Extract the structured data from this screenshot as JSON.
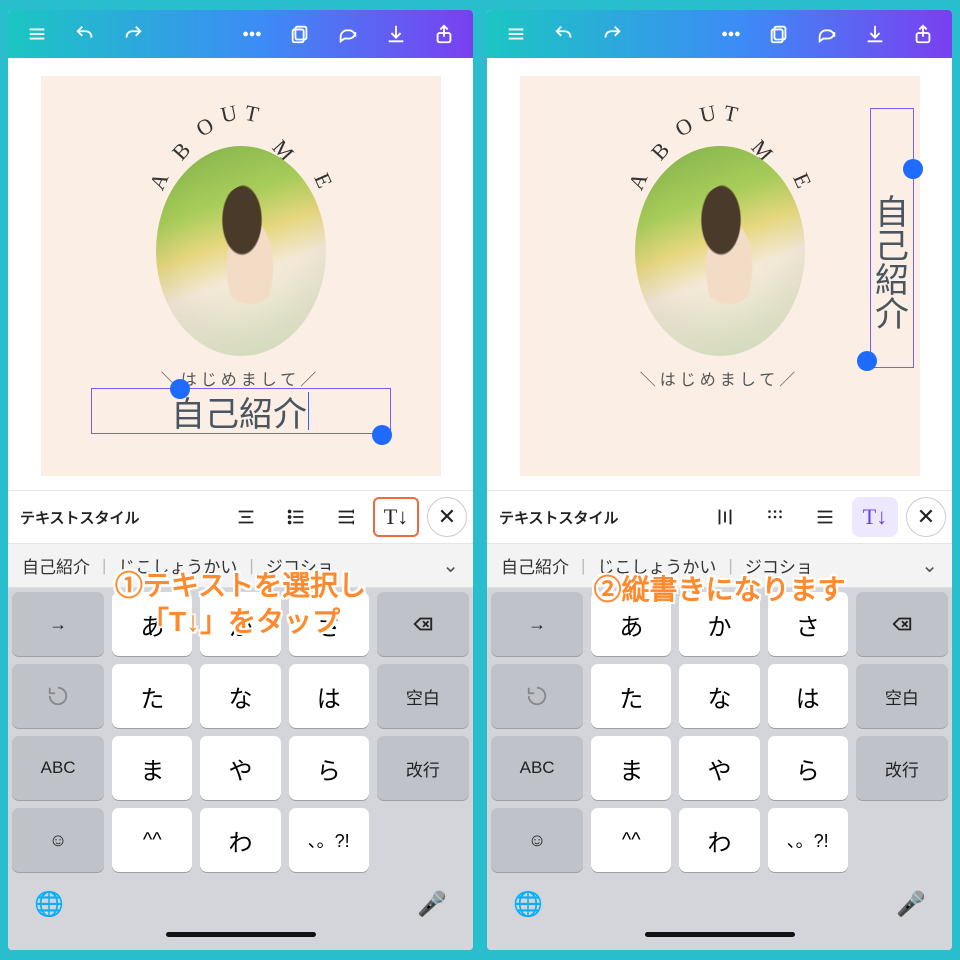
{
  "topbar": {
    "icons": [
      "menu",
      "undo",
      "redo",
      "more",
      "pages",
      "comment",
      "download",
      "share"
    ]
  },
  "canvas": {
    "arc_text": "ABOUT ME",
    "subtitle": "＼はじめまして／",
    "selected_text": "自己紹介"
  },
  "toolbar": {
    "left": {
      "label": "テキストスタイル",
      "buttons": [
        "align",
        "list",
        "line-spacing",
        "vertical-text"
      ],
      "highlighted": "vertical-text"
    },
    "right": {
      "label": "テキストスタイル",
      "buttons": [
        "align-v",
        "dots",
        "line-spacing",
        "vertical-text"
      ],
      "active": "vertical-text"
    },
    "close": "×"
  },
  "suggestions": {
    "items": [
      "自己紹介",
      "じこしょうかい",
      "ジコショ"
    ],
    "chevron": "⌄"
  },
  "annotations": {
    "left_line1": "①テキストを選択し",
    "left_line2": "「T↓」をタップ",
    "right": "②縦書きになります"
  },
  "keyboard": {
    "rows": [
      [
        "→",
        "あ",
        "か",
        "さ",
        "⌫"
      ],
      [
        "↺",
        "た",
        "な",
        "は",
        "空白"
      ],
      [
        "ABC",
        "ま",
        "や",
        "ら",
        "改行"
      ],
      [
        "☺",
        "^^",
        "わ",
        "、。?!",
        ""
      ]
    ],
    "globe": "🌐",
    "mic": "🎙"
  }
}
